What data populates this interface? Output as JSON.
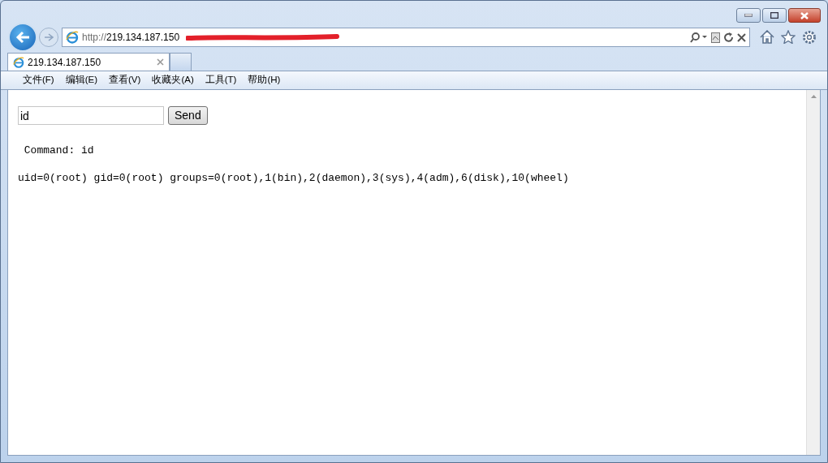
{
  "address_bar": {
    "scheme": "http://",
    "host": "219.134.187.150",
    "redacted": true
  },
  "tabs": [
    {
      "label": "219.134.187.150",
      "selected": true
    }
  ],
  "menu": [
    "文件(F)",
    "编辑(E)",
    "查看(V)",
    "收藏夹(A)",
    "工具(T)",
    "帮助(H)"
  ],
  "page": {
    "command_field": {
      "value": "id"
    },
    "send_button": "Send",
    "command_line": " Command: id",
    "output": "uid=0(root) gid=0(root) groups=0(root),1(bin),2(daemon),3(sys),4(adm),6(disk),10(wheel)"
  }
}
